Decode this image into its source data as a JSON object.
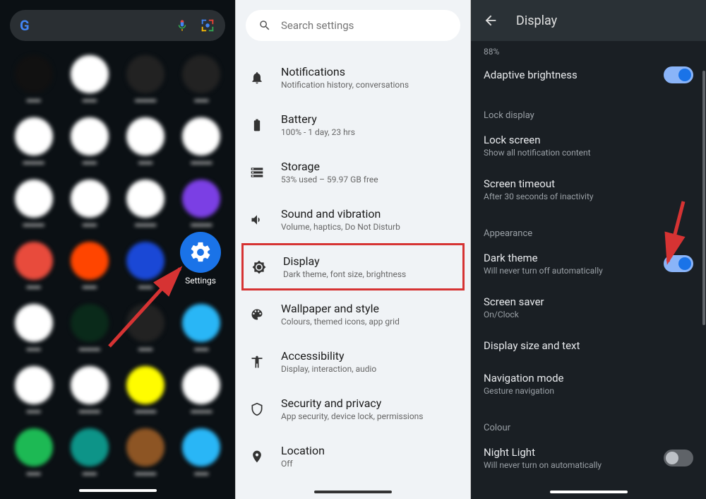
{
  "panel1": {
    "search_placeholder": "",
    "settings_label": "Settings"
  },
  "panel2": {
    "search_placeholder": "Search settings",
    "items": [
      {
        "title": "Notifications",
        "sub": "Notification history, conversations"
      },
      {
        "title": "Battery",
        "sub": "100% - 1 day, 23 hrs"
      },
      {
        "title": "Storage",
        "sub": "53% used – 59.97 GB free"
      },
      {
        "title": "Sound and vibration",
        "sub": "Volume, haptics, Do Not Disturb"
      },
      {
        "title": "Display",
        "sub": "Dark theme, font size, brightness"
      },
      {
        "title": "Wallpaper and style",
        "sub": "Colours, themed icons, app grid"
      },
      {
        "title": "Accessibility",
        "sub": "Display, interaction, audio"
      },
      {
        "title": "Security and privacy",
        "sub": "App security, device lock, permissions"
      },
      {
        "title": "Location",
        "sub": "Off"
      }
    ]
  },
  "panel3": {
    "title": "Display",
    "brightness_pct": "88%",
    "sections": {
      "lock_display": "Lock display",
      "appearance": "Appearance",
      "colour": "Colour"
    },
    "items": {
      "adaptive": {
        "title": "Adaptive brightness",
        "on": true
      },
      "lock_screen": {
        "title": "Lock screen",
        "sub": "Show all notification content"
      },
      "timeout": {
        "title": "Screen timeout",
        "sub": "After 30 seconds of inactivity"
      },
      "dark_theme": {
        "title": "Dark theme",
        "sub": "Will never turn off automatically",
        "on": true
      },
      "screen_saver": {
        "title": "Screen saver",
        "sub": "On/Clock"
      },
      "display_size": {
        "title": "Display size and text"
      },
      "nav_mode": {
        "title": "Navigation mode",
        "sub": "Gesture navigation"
      },
      "night_light": {
        "title": "Night Light",
        "sub": "Will never turn on automatically",
        "on": false
      }
    }
  }
}
